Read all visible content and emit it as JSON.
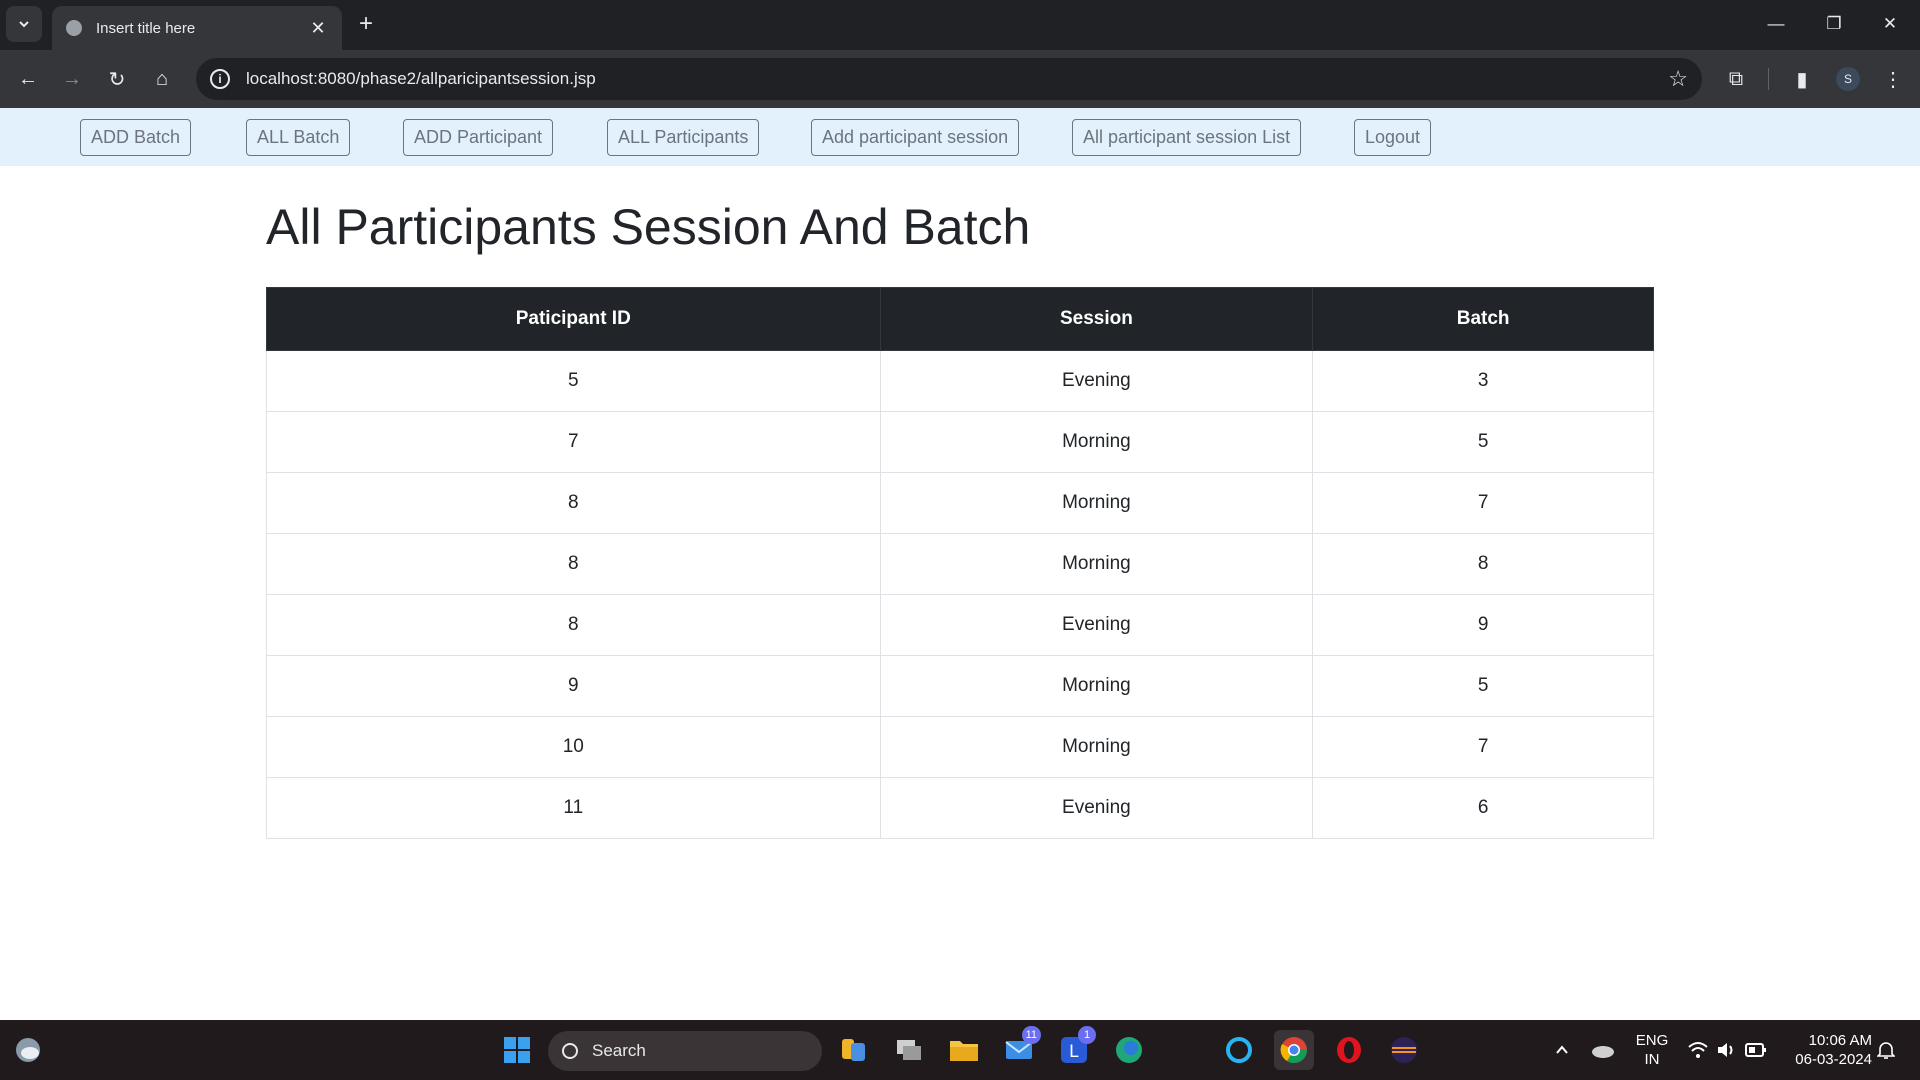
{
  "browser": {
    "tab_title": "Insert title here",
    "url": "localhost:8080/phase2/allparicipantsession.jsp",
    "profile_initial": "S"
  },
  "nav": {
    "buttons": [
      {
        "label": "ADD Batch"
      },
      {
        "label": "ALL Batch"
      },
      {
        "label": "ADD Participant"
      },
      {
        "label": "ALL Participants"
      },
      {
        "label": "Add participant session"
      },
      {
        "label": "All participant session List"
      },
      {
        "label": "Logout"
      }
    ]
  },
  "main": {
    "title": "All Participants Session And Batch",
    "table": {
      "headers": [
        "Paticipant ID",
        "Session",
        "Batch"
      ],
      "rows": [
        [
          "5",
          "Evening",
          "3"
        ],
        [
          "7",
          "Morning",
          "5"
        ],
        [
          "8",
          "Morning",
          "7"
        ],
        [
          "8",
          "Morning",
          "8"
        ],
        [
          "8",
          "Evening",
          "9"
        ],
        [
          "9",
          "Morning",
          "5"
        ],
        [
          "10",
          "Morning",
          "7"
        ],
        [
          "11",
          "Evening",
          "6"
        ]
      ]
    }
  },
  "taskbar": {
    "search_placeholder": "Search",
    "mail_badge": "11",
    "app_badge": "1",
    "lang_line1": "ENG",
    "lang_line2": "IN",
    "time": "10:06 AM",
    "date": "06-03-2024"
  }
}
